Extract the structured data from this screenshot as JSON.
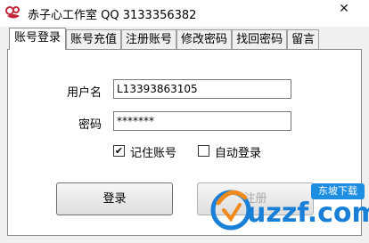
{
  "window": {
    "title": "赤子心工作室 QQ 3133356382",
    "close_glyph": "✕"
  },
  "tabs": [
    {
      "label": "账号登录",
      "active": true
    },
    {
      "label": "账号充值",
      "active": false
    },
    {
      "label": "注册账号",
      "active": false
    },
    {
      "label": "修改密码",
      "active": false
    },
    {
      "label": "找回密码",
      "active": false
    },
    {
      "label": "留言",
      "active": false
    }
  ],
  "login": {
    "username_label": "用户名",
    "username_value": "L13393863105",
    "password_label": "密码",
    "password_value": "*******",
    "remember_label": "记住账号",
    "remember_checked": true,
    "remember_mark": "✔",
    "autologin_label": "自动登录",
    "autologin_checked": false,
    "login_button": "登录",
    "second_button": "注册"
  },
  "watermark": {
    "badge": "东坡下载",
    "text": "uzzf.com"
  },
  "colors": {
    "title_icon": "#c0283a",
    "watermark_blue": "#1a7fd6",
    "watermark_orange": "#f08a1c"
  }
}
